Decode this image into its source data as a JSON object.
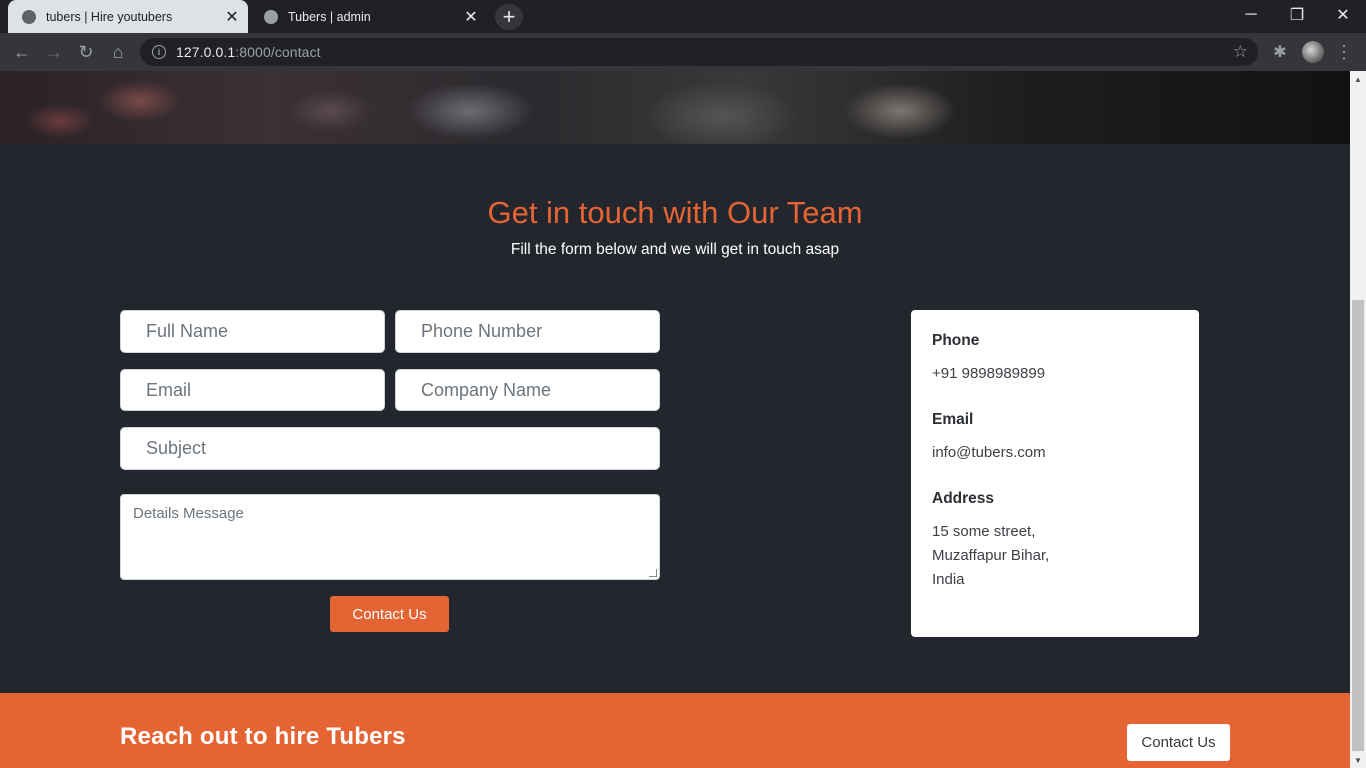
{
  "browser": {
    "tabs": [
      {
        "title": "tubers | Hire youtubers",
        "active": true
      },
      {
        "title": "Tubers | admin",
        "active": false
      }
    ],
    "url_host": "127.0.0.1",
    "url_rest": ":8000/contact"
  },
  "contact": {
    "title": "Get in touch with Our Team",
    "subtitle": "Fill the form below and we will get in touch asap",
    "form": {
      "full_name_placeholder": "Full Name",
      "phone_placeholder": "Phone Number",
      "email_placeholder": "Email",
      "company_placeholder": "Company Name",
      "subject_placeholder": "Subject",
      "message_placeholder": "Details Message",
      "submit_label": "Contact Us"
    },
    "info": {
      "phone_label": "Phone",
      "phone_value": "+91 9898989899",
      "email_label": "Email",
      "email_value": "info@tubers.com",
      "address_label": "Address",
      "address_line1": "15 some street,",
      "address_line2": "Muzaffapur Bihar,",
      "address_line3": "India"
    }
  },
  "cta": {
    "title": "Reach out to hire Tubers",
    "button_label": "Contact Us"
  },
  "colors": {
    "accent": "#e56434",
    "page_bg": "#23262d"
  }
}
